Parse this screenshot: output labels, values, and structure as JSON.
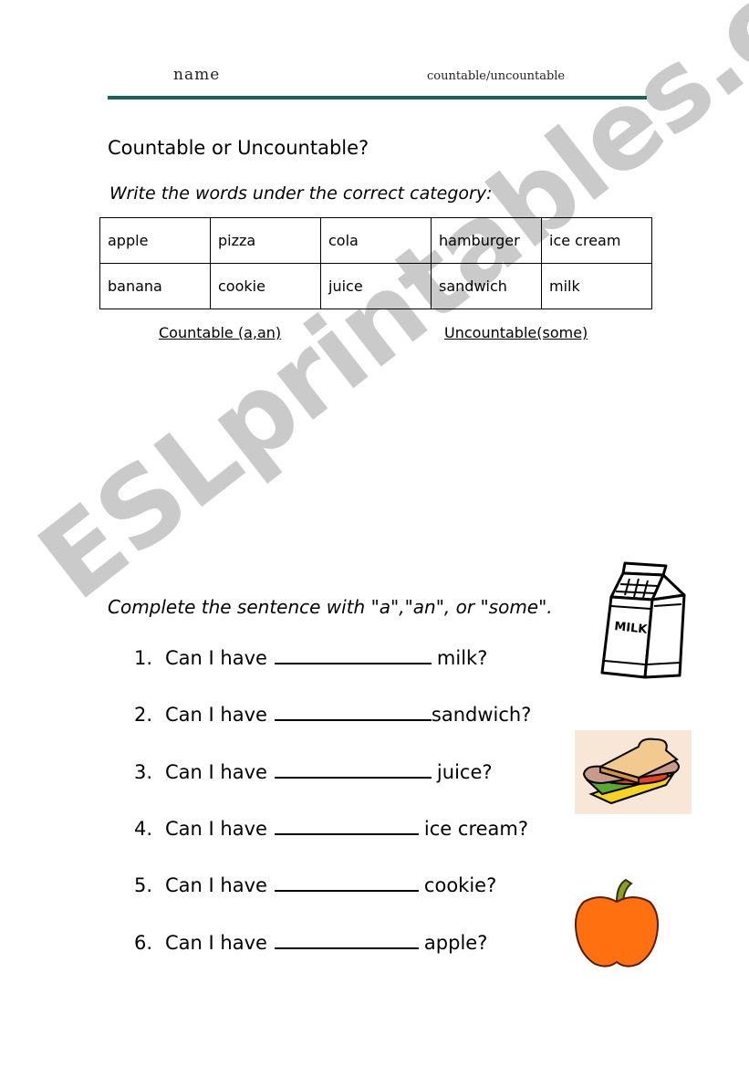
{
  "header": {
    "name_label": "name",
    "topic_label": "countable/uncountable",
    "rule_color": "#1a6357"
  },
  "title": "Countable or Uncountable?",
  "instruction_1": "Write the words under the correct category:",
  "word_table": {
    "rows": [
      [
        "apple",
        "pizza",
        "cola",
        "hamburger",
        "ice cream"
      ],
      [
        "banana",
        "cookie",
        "juice",
        "sandwich",
        "milk"
      ]
    ]
  },
  "categories": {
    "countable": "Countable (a,an)",
    "uncountable": "Uncountable(some)"
  },
  "instruction_2": "Complete the sentence with \"a\",\"an\", or \"some\".",
  "questions": [
    {
      "number": "1.",
      "prefix": "Can I have",
      "suffix": "milk?"
    },
    {
      "number": "2.",
      "prefix": "Can I have",
      "suffix": "sandwich?"
    },
    {
      "number": "3.",
      "prefix": "Can I have",
      "suffix": "juice?"
    },
    {
      "number": "4.",
      "prefix": "Can I have",
      "suffix": "ice cream?"
    },
    {
      "number": "5.",
      "prefix": "Can I have",
      "suffix": "cookie?"
    },
    {
      "number": "6.",
      "prefix": "Can I have",
      "suffix": "apple?"
    }
  ],
  "illustrations": {
    "milk_label": "MILK"
  },
  "watermark": "ESLprintables.com"
}
